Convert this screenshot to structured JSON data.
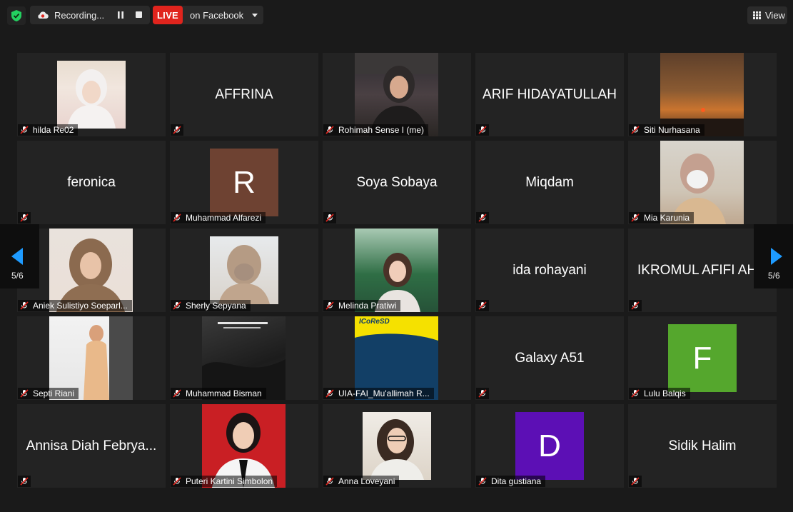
{
  "header": {
    "recording_label": "Recording...",
    "live_badge": "LIVE",
    "live_target": "on Facebook",
    "view_label": "View"
  },
  "pager": {
    "left_label": "5/6",
    "right_label": "5/6"
  },
  "colors": {
    "live_red": "#e0241d",
    "tile_bg": "#232323",
    "mute_red": "#e0241d"
  },
  "participants": [
    {
      "display": "",
      "label": "hilda Re02"
    },
    {
      "display": "AFFRINA",
      "label": ""
    },
    {
      "display": "",
      "label": "Rohimah Sense  I (me)"
    },
    {
      "display": "ARIF HIDAYATULLAH",
      "label": ""
    },
    {
      "display": "",
      "label": "Siti Nurhasana"
    },
    {
      "display": "feronica",
      "label": ""
    },
    {
      "display": "R",
      "label": "Muhammad Alfarezi"
    },
    {
      "display": "Soya Sobaya",
      "label": ""
    },
    {
      "display": "Miqdam",
      "label": ""
    },
    {
      "display": "",
      "label": "Mia Karunia"
    },
    {
      "display": "",
      "label": "Aniek Sulistiyo Soeparl..."
    },
    {
      "display": "",
      "label": "Sherly Sepyana"
    },
    {
      "display": "",
      "label": "Melinda Pratiwi"
    },
    {
      "display": "ida rohayani",
      "label": ""
    },
    {
      "display": "IKROMUL AFIFI AH...",
      "label": ""
    },
    {
      "display": "",
      "label": "Septi Riani"
    },
    {
      "display": "",
      "label": "Muhammad Bisman"
    },
    {
      "display": "ICoReSD",
      "label": "UIA-FAI_Mu'allimah R..."
    },
    {
      "display": "Galaxy A51",
      "label": ""
    },
    {
      "display": "F",
      "label": "Lulu Balqis"
    },
    {
      "display": "Annisa Diah Febrya...",
      "label": ""
    },
    {
      "display": "",
      "label": "Puteri Kartini Simbolon"
    },
    {
      "display": "",
      "label": "Anna Loveyani"
    },
    {
      "display": "D",
      "label": "Dita gustiana"
    },
    {
      "display": "Sidik Halim",
      "label": ""
    }
  ]
}
